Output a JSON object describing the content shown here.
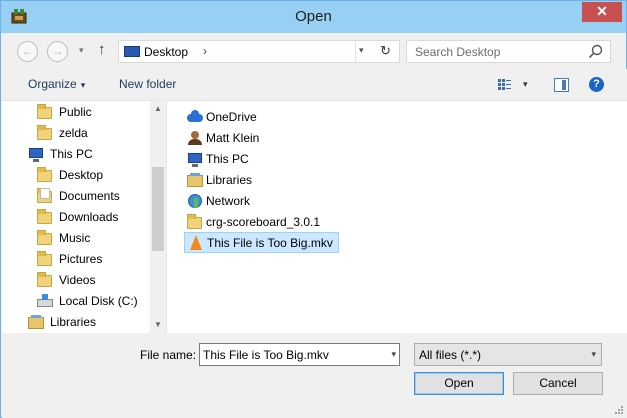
{
  "window": {
    "title": "Open",
    "app_icon": "dosbox-icon",
    "close_glyph": "✕"
  },
  "nav": {
    "back_glyph": "←",
    "forward_glyph": "→",
    "recent_glyph": "▾",
    "up_glyph": "↑",
    "address": {
      "icon": "desktop-icon",
      "location": "Desktop",
      "chevron": "›",
      "dropdown_glyph": "▾",
      "refresh_glyph": "↻"
    },
    "search": {
      "placeholder": "Search Desktop",
      "icon": "search-icon"
    }
  },
  "toolbar": {
    "organize_label": "Organize",
    "organize_caret": "▾",
    "new_folder_label": "New folder",
    "view_icon": "view-options-icon",
    "view_caret": "▾",
    "preview_pane_icon": "preview-pane-icon",
    "help_label": "?"
  },
  "sidebar": {
    "items": [
      {
        "label": "Public",
        "icon": "folder-icon",
        "indent": 1
      },
      {
        "label": "zelda",
        "icon": "folder-icon",
        "indent": 1
      },
      {
        "label": "This PC",
        "icon": "computer-icon",
        "indent": 0
      },
      {
        "label": "Desktop",
        "icon": "desktop-folder-icon",
        "indent": 1
      },
      {
        "label": "Documents",
        "icon": "documents-folder-icon",
        "indent": 1
      },
      {
        "label": "Downloads",
        "icon": "downloads-folder-icon",
        "indent": 1
      },
      {
        "label": "Music",
        "icon": "music-folder-icon",
        "indent": 1
      },
      {
        "label": "Pictures",
        "icon": "pictures-folder-icon",
        "indent": 1
      },
      {
        "label": "Videos",
        "icon": "videos-folder-icon",
        "indent": 1
      },
      {
        "label": "Local Disk (C:)",
        "icon": "hard-disk-icon",
        "indent": 1
      },
      {
        "label": "Libraries",
        "icon": "libraries-icon",
        "indent": 0
      }
    ],
    "scroll_up_glyph": "▲",
    "scroll_down_glyph": "▼"
  },
  "content": {
    "items": [
      {
        "label": "OneDrive",
        "icon": "onedrive-icon",
        "selected": false
      },
      {
        "label": "Matt Klein",
        "icon": "user-folder-icon",
        "selected": false
      },
      {
        "label": "This PC",
        "icon": "computer-icon",
        "selected": false
      },
      {
        "label": "Libraries",
        "icon": "libraries-icon",
        "selected": false
      },
      {
        "label": "Network",
        "icon": "network-icon",
        "selected": false
      },
      {
        "label": "crg-scoreboard_3.0.1",
        "icon": "folder-icon",
        "selected": false
      },
      {
        "label": "This File is Too Big.mkv",
        "icon": "vlc-media-icon",
        "selected": true
      }
    ]
  },
  "footer": {
    "file_name_label": "File name:",
    "file_name_value": "This File is Too Big.mkv",
    "file_name_dropdown_glyph": "▾",
    "file_type_value": "All files (*.*)",
    "file_type_dropdown_glyph": "▾",
    "open_label": "Open",
    "cancel_label": "Cancel"
  },
  "colors": {
    "titlebar": "#97d0f3",
    "close_button": "#c75050",
    "selection": "#cce8ff",
    "selection_border": "#99d1ff",
    "link_text": "#1e395b"
  }
}
